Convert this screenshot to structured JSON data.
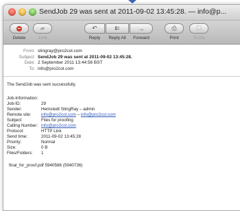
{
  "window": {
    "title": "SendJob 29 was sent at 2011-09-02 13:45:28. — info@p..."
  },
  "toolbar": {
    "buttons": [
      {
        "label": "Delete"
      },
      {
        "label": "Junk"
      },
      {
        "label": "Reply"
      },
      {
        "label": "Reply All"
      },
      {
        "label": "Forward"
      },
      {
        "label": "Print"
      },
      {
        "label": "To Do"
      }
    ]
  },
  "header": {
    "from_key": "From:",
    "from_value": "stingray@pro2col.com",
    "subject_key": "Subject:",
    "subject_value": "SendJob 29 was sent at 2011-09-02 13:45:28.",
    "date_key": "Date:",
    "date_value": "2 September 2011 13:44:56 BST",
    "to_key": "To:",
    "to_value": "info@pro2col.com"
  },
  "body": {
    "intro": "The SendJob was sent successfully.",
    "info_heading": "Job-Information:",
    "rows": [
      {
        "key": "Job-ID:",
        "value": "29"
      },
      {
        "key": "Sender:",
        "value": "Hemstedt StingRay – admin"
      },
      {
        "key": "Remote site:",
        "value": "info@pro2col.com",
        "sep": " – ",
        "value2": "info@pro2col.com"
      },
      {
        "key": "Subject:",
        "value": "Files for proofing"
      },
      {
        "key": "Calling Number:",
        "value": "info@pro2col.com"
      },
      {
        "key": "Protocol:",
        "value": "HTTP Link"
      },
      {
        "key": "Send time:",
        "value": "2011-09-02 13:45:28"
      },
      {
        "key": "Priority:",
        "value": "Normal"
      },
      {
        "key": "Size:",
        "value": "0 B"
      },
      {
        "key": "Files/Folders:",
        "value": "1"
      }
    ],
    "attachment": "final_for_proof.pdf 5940586 (5940736)"
  }
}
